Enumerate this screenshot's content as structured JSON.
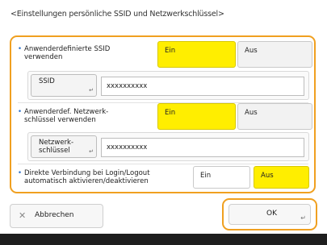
{
  "title": "<Einstellungen persönliche SSID und Netzwerkschlüssel>",
  "rows": [
    {
      "label_line1": "Anwenderdefinierte SSID",
      "label_line2": "verwenden",
      "on": "Ein",
      "off": "Aus",
      "selected": "on",
      "field_button_line1": "SSID",
      "field_button_line2": "",
      "field_value": "xxxxxxxxxx"
    },
    {
      "label_line1": "Anwenderdef. Netzwerk-",
      "label_line2": "schlüssel verwenden",
      "on": "Ein",
      "off": "Aus",
      "selected": "on",
      "field_button_line1": "Netzwerk-",
      "field_button_line2": "schlüssel",
      "field_value": "xxxxxxxxxx"
    },
    {
      "label_line1": "Direkte Verbindung bei Login/Logout",
      "label_line2": "automatisch aktivieren/deaktivieren",
      "on": "Ein",
      "off": "Aus",
      "selected": "off"
    }
  ],
  "footer": {
    "cancel": "Abbrechen",
    "ok": "OK"
  },
  "colors": {
    "accent": "#f0a020",
    "selected": "#ffee00"
  }
}
